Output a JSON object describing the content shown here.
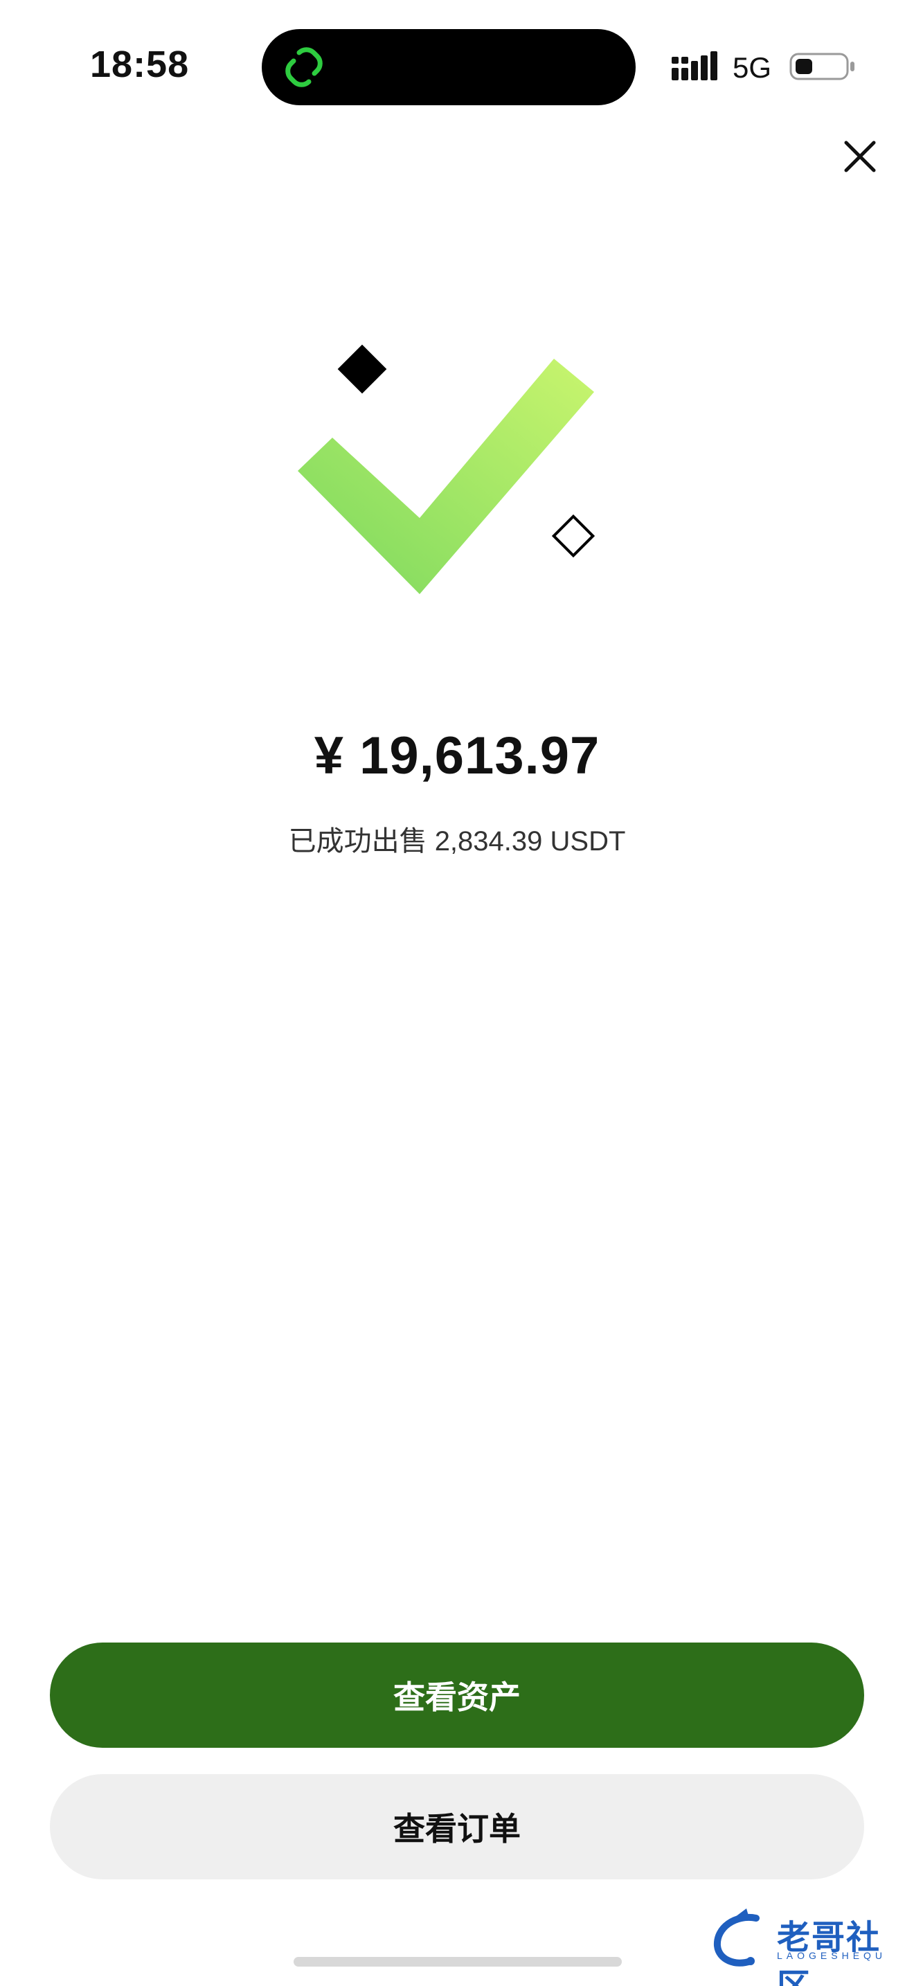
{
  "status_bar": {
    "time": "18:58",
    "network": "5G",
    "icons": [
      "link-app-icon",
      "signal-icon",
      "battery-icon"
    ]
  },
  "close": {
    "icon": "close-icon"
  },
  "success": {
    "icon": "checkmark-icon",
    "amount": "¥ 19,613.97",
    "message": "已成功出售 2,834.39 USDT"
  },
  "actions": {
    "view_assets_label": "查看资产",
    "view_orders_label": "查看订单"
  },
  "watermark": {
    "text": "老哥社区",
    "subtext": "LAOGESHEQU"
  },
  "colors": {
    "primary": "#2d6e19",
    "secondary_bg": "#efefef",
    "check_light": "#c9f56e",
    "check_dark": "#7bd85e"
  }
}
